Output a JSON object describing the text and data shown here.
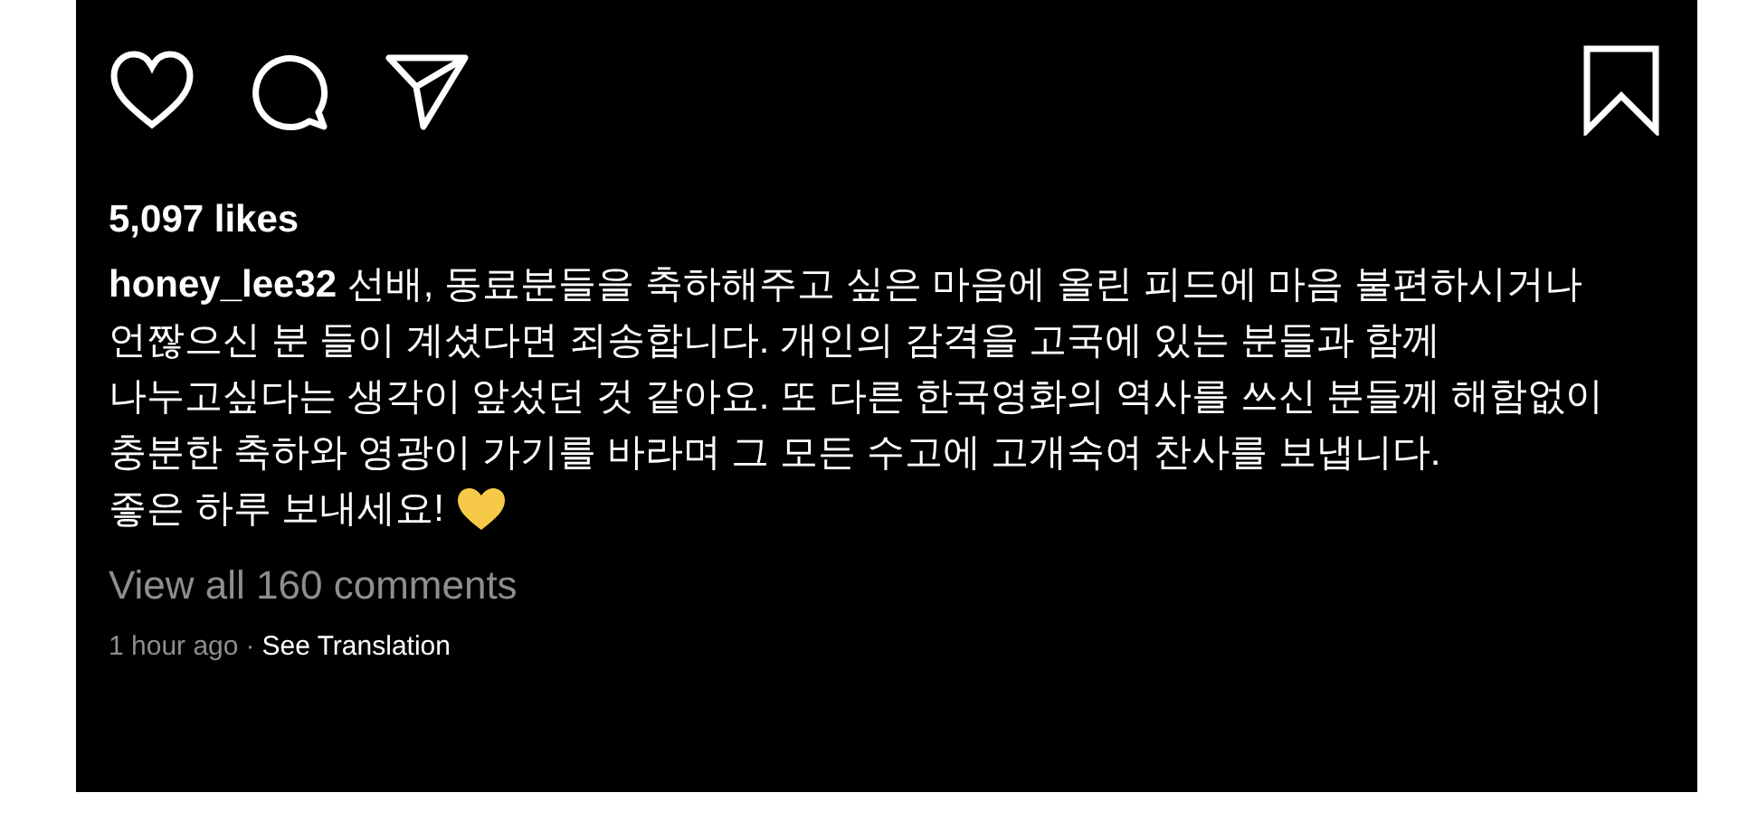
{
  "post": {
    "likes": "5,097 likes",
    "caption": "**honey_lee32** 선배, 동료분들을 축하해주고 싶은 마음에 올린 피드에 마음 불편하시거나 언짢으신 분 들이 계셨다면 죄송합니다. 개인의 감격을 고국에 있는 분들과 함께 나누고싶다는 생각이 앞섰던 것 같아요. 또 다른 한국영화의 역사를 쓰신 분들께 해함없이 충분한 축하와 영광이 가기를 바라며 그 모든 수고에 고개숙여 찬사를 보냅니다.",
    "closing": "좋은 하루 보내세요!",
    "comments_link": "View all 160 comments",
    "time": "1 hour ago",
    "separator": "·",
    "translation_link": "See Translation"
  }
}
